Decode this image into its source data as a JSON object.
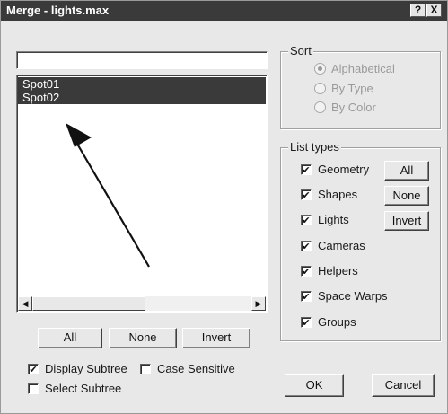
{
  "window": {
    "title": "Merge - lights.max",
    "help_label": "?",
    "close_label": "X"
  },
  "filter": {
    "value": ""
  },
  "list": {
    "items": [
      "Spot01",
      "Spot02"
    ],
    "selected": [
      "Spot01",
      "Spot02"
    ]
  },
  "list_buttons": {
    "all": "All",
    "none": "None",
    "invert": "Invert"
  },
  "options": {
    "display_subtree": {
      "label": "Display Subtree",
      "checked": true
    },
    "case_sensitive": {
      "label": "Case Sensitive",
      "checked": false
    },
    "select_subtree": {
      "label": "Select Subtree",
      "checked": false
    }
  },
  "sort": {
    "label": "Sort",
    "options": [
      {
        "label": "Alphabetical",
        "selected": true
      },
      {
        "label": "By Type",
        "selected": false
      },
      {
        "label": "By Color",
        "selected": false
      }
    ],
    "enabled": false
  },
  "list_types": {
    "label": "List types",
    "items": [
      {
        "label": "Geometry",
        "checked": true
      },
      {
        "label": "Shapes",
        "checked": true
      },
      {
        "label": "Lights",
        "checked": true
      },
      {
        "label": "Cameras",
        "checked": true
      },
      {
        "label": "Helpers",
        "checked": true
      },
      {
        "label": "Space Warps",
        "checked": true
      },
      {
        "label": "Groups",
        "checked": true
      }
    ],
    "buttons": {
      "all": "All",
      "none": "None",
      "invert": "Invert"
    }
  },
  "dialog_buttons": {
    "ok": "OK",
    "cancel": "Cancel"
  },
  "annotation": {
    "icon": "arrow-icon"
  },
  "colors": {
    "titlebar": "#3a3a3a",
    "selection": "#3a3a3a",
    "face": "#e8e8e8"
  }
}
